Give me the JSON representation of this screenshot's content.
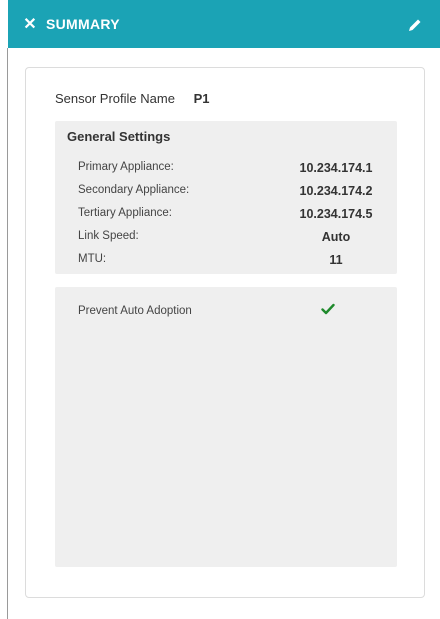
{
  "header": {
    "close_glyph": "✕",
    "title": "SUMMARY",
    "edit_icon": "pencil-icon",
    "bg_color": "#1ba3b5"
  },
  "profile": {
    "label": "Sensor Profile Name",
    "value": "P1"
  },
  "general": {
    "title": "General Settings",
    "rows": [
      {
        "label": "Primary Appliance:",
        "value": "10.234.174.1"
      },
      {
        "label": "Secondary Appliance:",
        "value": "10.234.174.2"
      },
      {
        "label": "Tertiary Appliance:",
        "value": "10.234.174.5"
      },
      {
        "label": "Link Speed:",
        "value": "Auto"
      },
      {
        "label": "MTU:",
        "value": "11"
      }
    ]
  },
  "adoption": {
    "label": "Prevent Auto Adoption",
    "enabled_icon": "check-icon",
    "check_color": "#1f8a2c"
  }
}
